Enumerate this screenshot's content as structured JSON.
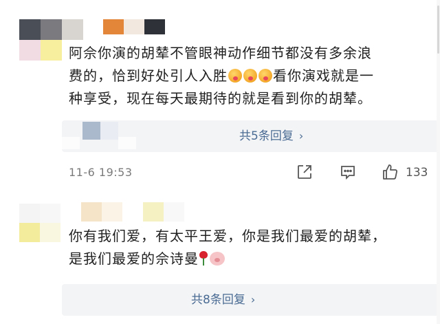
{
  "comments": [
    {
      "text_line1": "阿佘你演的胡辇不管眼神动作细节都没有多余浪",
      "text_line2a": "费的，恰到好处引人入胜",
      "text_line2b": "看你演戏就是一",
      "text_line3": "种享受，现在每天最期待的就是看到你的胡辇。",
      "reply_label": "共5条回复",
      "chevron": "›",
      "timestamp": "11-6 19:53",
      "like_count": "133",
      "emoji_icon": "drooling-face-icon"
    },
    {
      "text_line1": "你有我们爱，有太平王爱，你是我们最爱的胡辇，",
      "text_line2": "是我们最爱的佘诗曼",
      "reply_label": "共8条回复",
      "chevron": "›",
      "emoji_icons": [
        "rose-icon",
        "pig-icon"
      ]
    }
  ],
  "colors": {
    "link": "#4a6b93",
    "reply_bg": "#f3f4f6",
    "meta": "#7a7a7a"
  }
}
